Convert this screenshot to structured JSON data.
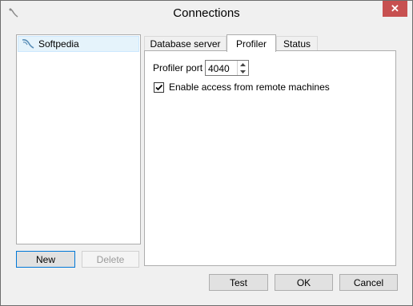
{
  "window": {
    "title": "Connections"
  },
  "connections": {
    "items": [
      {
        "label": "Softpedia"
      }
    ]
  },
  "left_buttons": {
    "new": "New",
    "delete": "Delete"
  },
  "tabs": [
    {
      "label": "Database server",
      "active": false
    },
    {
      "label": "Profiler",
      "active": true
    },
    {
      "label": "Status",
      "active": false
    }
  ],
  "profiler": {
    "port_label": "Profiler port",
    "port_value": "4040",
    "remote_access_label": "Enable access from remote machines",
    "remote_access_checked": true
  },
  "footer": {
    "test": "Test",
    "ok": "OK",
    "cancel": "Cancel"
  }
}
